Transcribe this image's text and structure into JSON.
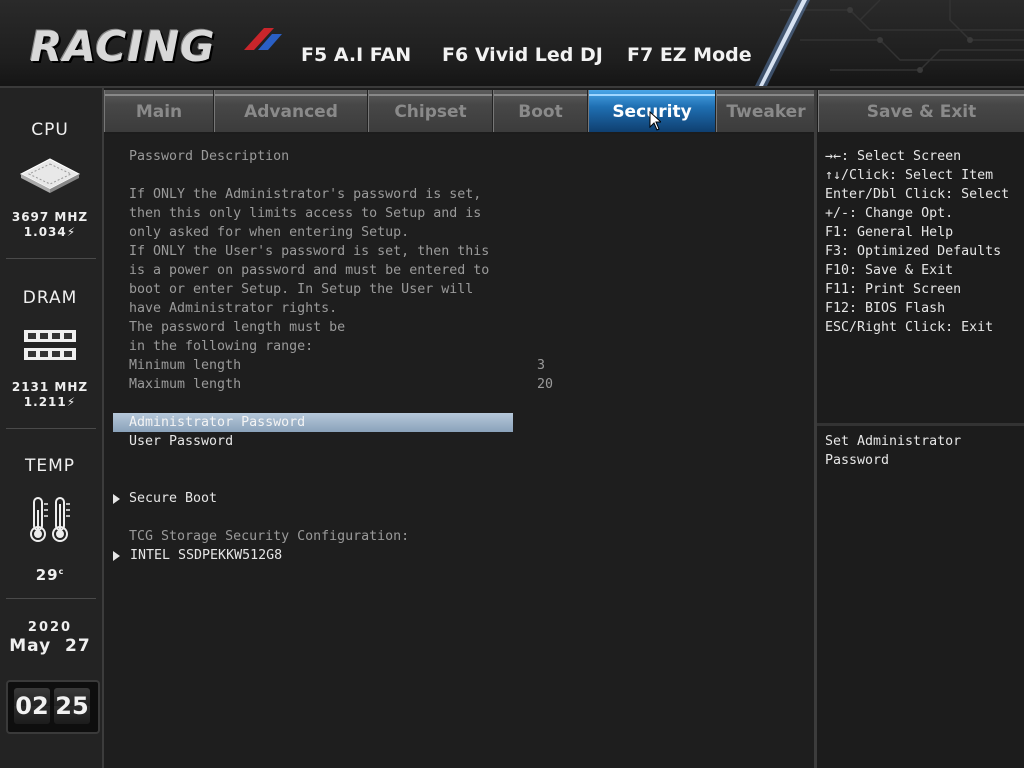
{
  "header": {
    "logo_text": "RACING",
    "fkeys": [
      {
        "label": "F5 A.I FAN"
      },
      {
        "label": "F6 Vivid Led DJ"
      },
      {
        "label": "F7 EZ Mode"
      }
    ]
  },
  "sidebar": {
    "cpu": {
      "title": "CPU",
      "freq": "3697 MHZ",
      "volt": "1.034"
    },
    "dram": {
      "title": "DRAM",
      "freq": "2131 MHZ",
      "volt": "1.211"
    },
    "temp": {
      "title": "TEMP",
      "value": "29",
      "unit": "c"
    },
    "date": {
      "year": "2020",
      "month_day": "May  27"
    },
    "clock": {
      "hour": "02",
      "minute": "25"
    }
  },
  "tabs": [
    {
      "label": "Main"
    },
    {
      "label": "Advanced"
    },
    {
      "label": "Chipset"
    },
    {
      "label": "Boot"
    },
    {
      "label": "Security",
      "active": true
    },
    {
      "label": "Tweaker"
    }
  ],
  "save_exit_tab": "Save & Exit",
  "main": {
    "heading": "Password Description",
    "description": [
      "If ONLY the Administrator's password is set,",
      "then this only limits access to Setup and is",
      "only asked for when entering Setup.",
      "If ONLY the User's password is set, then this",
      "is a power on password and must be entered to",
      "boot or enter Setup. In Setup the User will",
      "have Administrator rights.",
      "The password length must be",
      "in the following range:"
    ],
    "min_label": "Minimum length",
    "min_value": "3",
    "max_label": "Maximum length",
    "max_value": "20",
    "admin_password": "Administrator Password",
    "user_password": "User Password",
    "secure_boot": "Secure Boot",
    "tcg_label": "TCG Storage Security Configuration:",
    "ssd": "INTEL SSDPEKKW512G8"
  },
  "help": {
    "keys": [
      "→←: Select Screen",
      "↑↓/Click: Select Item",
      "Enter/Dbl Click: Select",
      "+/-: Change Opt.",
      "F1: General Help",
      "F3: Optimized Defaults",
      "F10: Save & Exit",
      "F11: Print Screen",
      "F12: BIOS Flash",
      "ESC/Right Click: Exit"
    ],
    "item_help": [
      "Set Administrator",
      "Password"
    ]
  },
  "colors": {
    "active_tab": "#1f6fb2",
    "highlight": "#9fb4ca",
    "background": "#1c1c1c"
  }
}
